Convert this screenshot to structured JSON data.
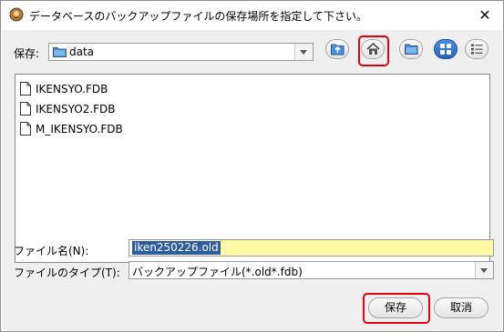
{
  "window": {
    "title": "データベースのバックアップファイルの保存場所を指定して下さい。",
    "close_glyph": "✕"
  },
  "save_in": {
    "label": "保存:",
    "value": "data"
  },
  "toolbar": {
    "icons": [
      "up-folder-icon",
      "home-icon",
      "new-folder-icon",
      "list-view-icon",
      "details-view-icon"
    ],
    "highlighted": "home-icon",
    "highlight_color": "#e60012"
  },
  "files": [
    {
      "name": "IKENSYO.FDB"
    },
    {
      "name": "IKENSYO2.FDB"
    },
    {
      "name": "M_IKENSYO.FDB"
    }
  ],
  "filename": {
    "label": "ファイル名(N):",
    "value": "iken250226.old"
  },
  "filetype": {
    "label": "ファイルのタイプ(T):",
    "value": "バックアップファイル(*.old*.fdb)"
  },
  "buttons": {
    "save": "保存",
    "cancel": "取消"
  },
  "colors": {
    "selection": "#2f5c9e",
    "input_highlight": "#fff9a6",
    "annotation_red": "#e60012"
  }
}
